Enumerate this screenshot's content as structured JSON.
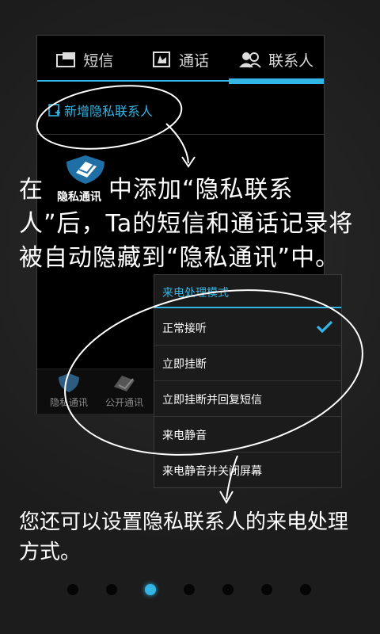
{
  "tabs": [
    {
      "label": "短信",
      "icon": "sms-icon"
    },
    {
      "label": "通话",
      "icon": "call-log-icon"
    },
    {
      "label": "联系人",
      "icon": "contacts-icon"
    }
  ],
  "add_contact_label": "新增隐私联系人",
  "private_app": {
    "label": "隐私通讯",
    "icon": "private-comm-icon"
  },
  "bottom_bar": [
    {
      "label": "隐私通讯",
      "icon": "private-comm-icon"
    },
    {
      "label": "公开通讯",
      "icon": "public-comm-icon"
    }
  ],
  "main_text": {
    "part1": "在",
    "part2": "中添加“隐私联系人”后，Ta的短信和通话记录将被自动隐藏到“隐私通讯”中。"
  },
  "menu": {
    "title": "来电处理模式",
    "items": [
      {
        "label": "正常接听",
        "selected": true
      },
      {
        "label": "立即挂断"
      },
      {
        "label": "立即挂断并回复短信"
      },
      {
        "label": "来电静音"
      },
      {
        "label": "来电静音并关闭屏幕"
      }
    ]
  },
  "sub_text": "您还可以设置隐私联系人的来电处理方式。",
  "pager": {
    "total": 7,
    "current": 3
  },
  "colors": {
    "accent": "#33b5e5",
    "background": "#202020"
  }
}
